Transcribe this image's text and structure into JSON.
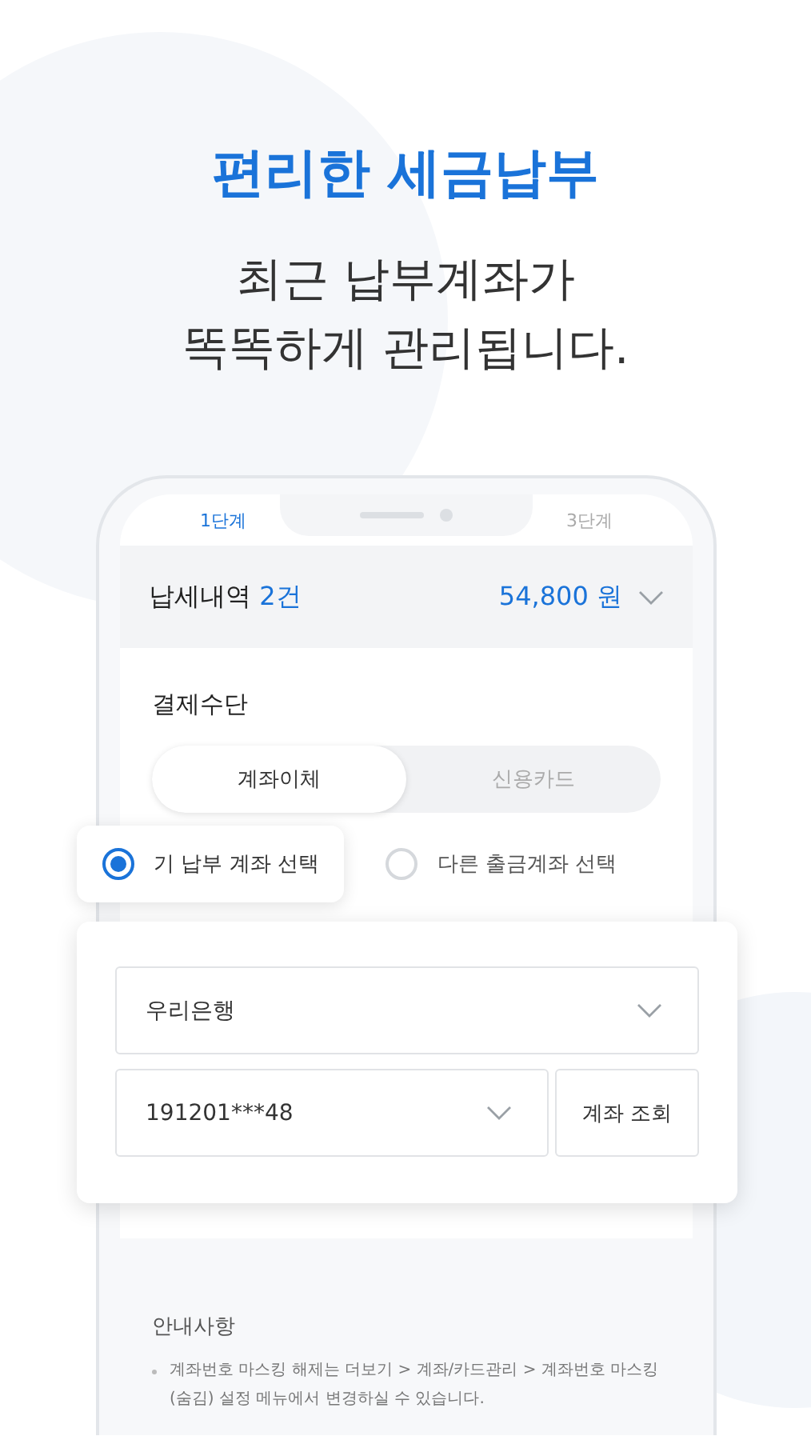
{
  "headline": "편리한 세금납부",
  "subtitle": [
    "최근 납부계좌가",
    "똑똑하게 관리됩니다."
  ],
  "steps": [
    {
      "label": "1단계",
      "selected": true
    },
    {
      "label": "3단계",
      "selected": false
    }
  ],
  "summary": {
    "label": "납세내역",
    "count": "2건",
    "amount": "54,800 원"
  },
  "payment": {
    "title": "결제수단",
    "tabs": [
      {
        "label": "계좌이체",
        "selected": true
      },
      {
        "label": "신용카드",
        "selected": false
      }
    ],
    "options": [
      {
        "label": "기 납부 계좌 선택",
        "selected": true
      },
      {
        "label": "다른 출금계좌 선택",
        "selected": false
      }
    ],
    "bank": {
      "value": "우리은행"
    },
    "account": {
      "value": "191201***48"
    },
    "lookup_button": "계좌 조회"
  },
  "notice": {
    "title": "안내사항",
    "items": [
      "계좌번호 마스킹 해제는 더보기 > 계좌/카드관리 > 계좌번호 마스킹(숨김) 설정 메뉴에서 변경하실 수 있습니다."
    ]
  }
}
